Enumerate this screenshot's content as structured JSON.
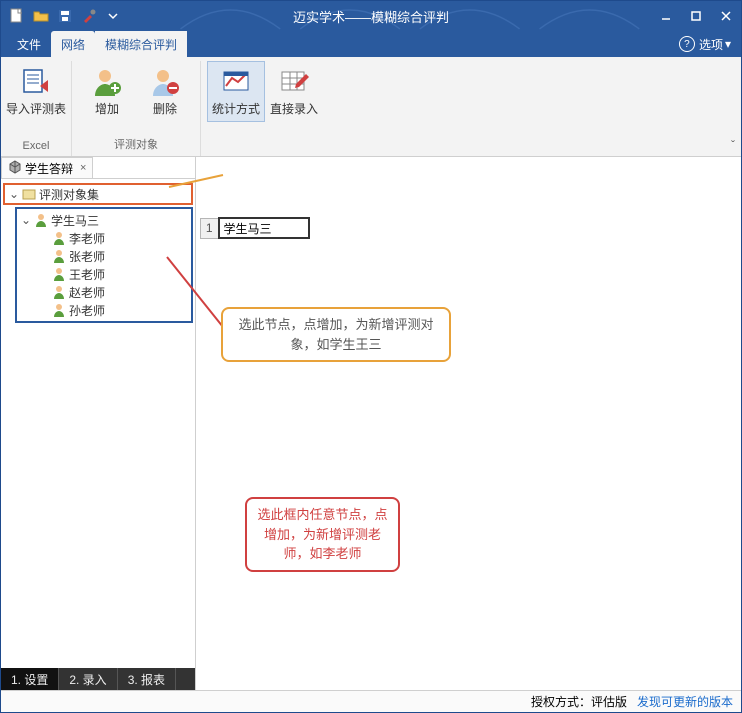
{
  "window": {
    "title": "迈实学术——模糊综合评判"
  },
  "menu": {
    "file": "文件",
    "network": "网络",
    "fuzzy": "模糊综合评判",
    "options": "选项"
  },
  "ribbon": {
    "import": "导入评测表",
    "add": "增加",
    "delete": "删除",
    "stat_method": "统计方式",
    "direct_entry": "直接录入",
    "group_excel": "Excel",
    "group_target": "评测对象"
  },
  "panel": {
    "tab_title": "学生答辩"
  },
  "tree": {
    "root": "评测对象集",
    "student": "学生马三",
    "teachers": [
      "李老师",
      "张老师",
      "王老师",
      "赵老师",
      "孙老师"
    ]
  },
  "grid": {
    "row1_index": "1",
    "row1_value": "学生马三"
  },
  "callouts": {
    "orange": "选此节点，点增加，为新增评测对象，如学生王三",
    "red": "选此框内任意节点，点增加，为新增评测老师，如李老师"
  },
  "bottom_tabs": {
    "settings": "1. 设置",
    "entry": "2. 录入",
    "report": "3. 报表"
  },
  "status": {
    "auth_mode": "授权方式：评估版",
    "update": "发现可更新的版本"
  }
}
